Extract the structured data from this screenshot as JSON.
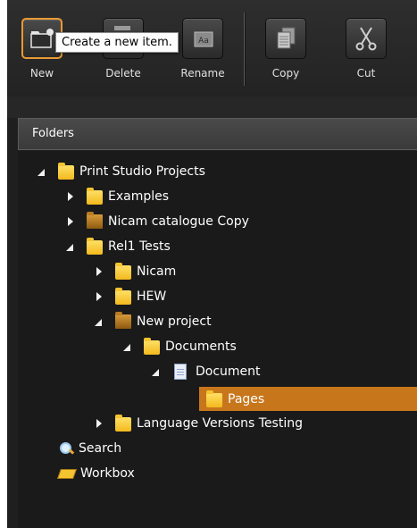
{
  "toolbar": {
    "buttons": [
      {
        "label": "New",
        "icon": "new-folder-icon"
      },
      {
        "label": "Delete",
        "icon": "delete-icon"
      },
      {
        "label": "Rename",
        "icon": "rename-icon"
      },
      {
        "label": "Copy",
        "icon": "copy-icon"
      },
      {
        "label": "Cut",
        "icon": "scissors-icon"
      }
    ],
    "tooltip": "Create a new item."
  },
  "panel": {
    "title": "Folders"
  },
  "tree": [
    {
      "label": "Print Studio Projects",
      "icon": "folder-icon"
    },
    {
      "label": "Examples",
      "icon": "folder-icon"
    },
    {
      "label": "Nicam catalogue Copy",
      "icon": "project-folder-icon"
    },
    {
      "label": "Rel1 Tests",
      "icon": "folder-icon"
    },
    {
      "label": "Nicam",
      "icon": "folder-icon"
    },
    {
      "label": "HEW",
      "icon": "folder-icon"
    },
    {
      "label": "New project",
      "icon": "project-folder-icon"
    },
    {
      "label": "Documents",
      "icon": "folder-icon"
    },
    {
      "label": "Document",
      "icon": "document-icon"
    },
    {
      "label": "Pages",
      "icon": "folder-icon",
      "selected": true
    },
    {
      "label": "Language Versions Testing",
      "icon": "folder-icon"
    }
  ],
  "footer_items": [
    {
      "label": "Search",
      "icon": "search-icon"
    },
    {
      "label": "Workbox",
      "icon": "workbox-icon"
    }
  ],
  "colors": {
    "selection": "#c8761c",
    "toolbar_bg": "#2a2a2a",
    "panel_bg": "#1a1a1a",
    "active_border": "#e89a35"
  }
}
